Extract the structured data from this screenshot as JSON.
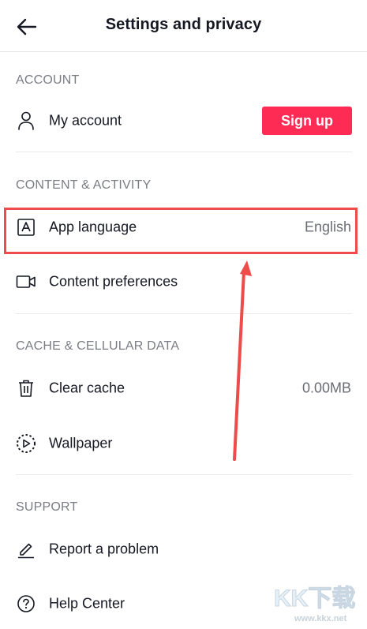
{
  "header": {
    "title": "Settings and privacy",
    "back_icon": "back-arrow-icon"
  },
  "sections": [
    {
      "header": "ACCOUNT",
      "items": [
        {
          "label": "My account",
          "icon": "person-icon",
          "action_label": "Sign up"
        }
      ]
    },
    {
      "header": "CONTENT & ACTIVITY",
      "items": [
        {
          "label": "App language",
          "icon": "language-icon",
          "value": "English"
        },
        {
          "label": "Content preferences",
          "icon": "video-camera-icon"
        }
      ]
    },
    {
      "header": "CACHE & CELLULAR DATA",
      "items": [
        {
          "label": "Clear cache",
          "icon": "trash-icon",
          "value": "0.00MB"
        },
        {
          "label": "Wallpaper",
          "icon": "wallpaper-icon"
        }
      ]
    },
    {
      "header": "SUPPORT",
      "items": [
        {
          "label": "Report a problem",
          "icon": "pencil-icon"
        },
        {
          "label": "Help Center",
          "icon": "help-icon"
        }
      ]
    }
  ],
  "colors": {
    "accent": "#fe2c55",
    "annotation": "#ee4b4b",
    "section_header": "#7b7d85",
    "text": "#161823"
  },
  "watermark": {
    "brand": "KK下载",
    "url": "www.kkx.net"
  }
}
